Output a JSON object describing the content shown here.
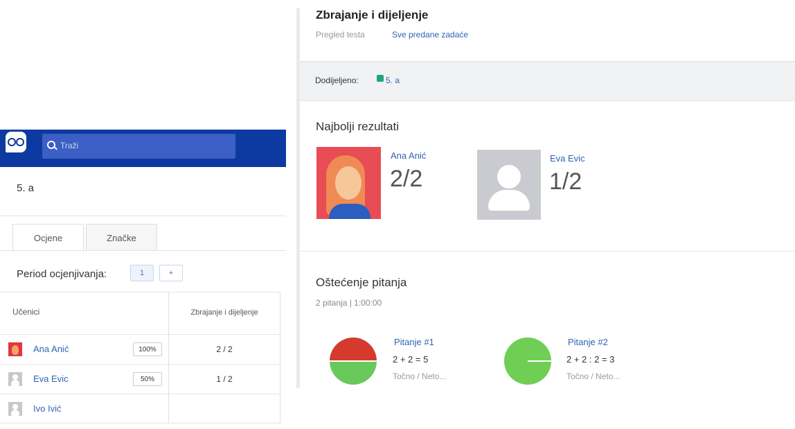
{
  "left": {
    "search_placeholder": "Traži",
    "class_name": "5. a",
    "tabs": [
      {
        "label": "Ocjene",
        "active": true
      },
      {
        "label": "Značke",
        "active": false
      }
    ],
    "period": {
      "label": "Period ocjenjivanja:",
      "selected": "1",
      "add": "+"
    },
    "table": {
      "col_students": "Učenici",
      "col_quiz": "Zbrajanje i dijeljenje",
      "rows": [
        {
          "name": "Ana Anić",
          "percent": "100%",
          "score": "2 / 2"
        },
        {
          "name": "Eva Evic",
          "percent": "50%",
          "score": "1 / 2"
        },
        {
          "name": "Ivo Ivić",
          "percent": "",
          "score": ""
        }
      ]
    }
  },
  "right": {
    "title": "Zbrajanje i dijeljenje",
    "breadcrumb_1": "Pregled testa",
    "breadcrumb_2": "Sve predane zadaće",
    "assigned_label": "Dodijeljeno:",
    "assigned_class": "5. a",
    "top_results_title": "Najbolji rezultati",
    "top_results": [
      {
        "name": "Ana Anić",
        "score": "2/2"
      },
      {
        "name": "Eva Evic",
        "score": "1/2"
      }
    ],
    "breakdown_title": "Oštećenje pitanja",
    "breakdown_meta": "2 pitanja | 1:00:00",
    "questions": [
      {
        "title": "Pitanje #1",
        "expr": "2 + 2 = 5",
        "sub": "Točno / Neto...",
        "correct_fraction": 0.5
      },
      {
        "title": "Pitanje #2",
        "expr": "2 + 2 : 2 = 3",
        "sub": "Točno / Neto...",
        "correct_fraction": 1.0
      }
    ]
  },
  "colors": {
    "brand": "#0d3aa0",
    "link": "#2f63b3",
    "correct": "#68c95a",
    "incorrect": "#d53a2c",
    "class_tag": "#1fa57a"
  }
}
